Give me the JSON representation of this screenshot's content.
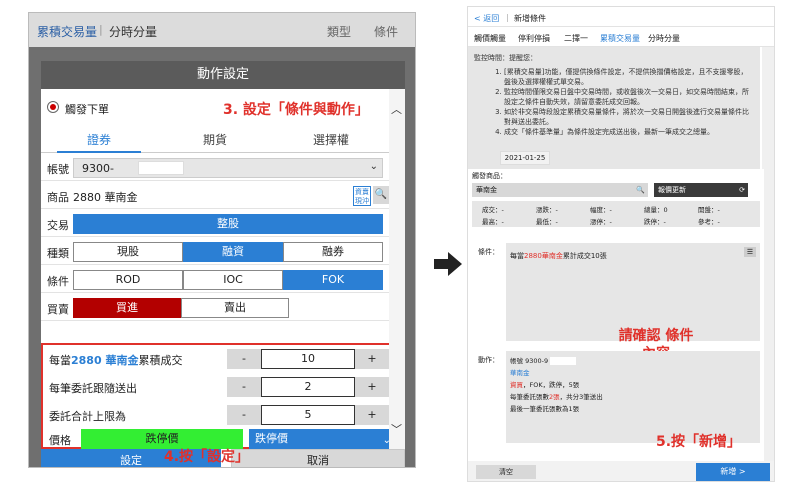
{
  "left": {
    "bg_tab1": "累積交易量",
    "bg_sep": "|",
    "bg_tab2": "分時分量",
    "bg_tab3": "類型",
    "bg_tab4": "條件",
    "dialog_title": "動作設定",
    "trigger_label": "觸發下單",
    "callout3": "3. 設定「條件與動作」",
    "tabs": [
      "證券",
      "期貨",
      "選擇權"
    ],
    "account_label": "帳號",
    "account_value": "9300-",
    "product_label": "商品",
    "product_value": "2880 華南金",
    "badge_text": "資賣現沖",
    "trade_label": "交易",
    "trade_value": "整股",
    "kind_label": "種類",
    "kinds": [
      "現股",
      "融資",
      "融券"
    ],
    "cond_label": "條件",
    "conds": [
      "ROD",
      "IOC",
      "FOK"
    ],
    "side_label": "買賣",
    "sides": [
      "買進",
      "賣出"
    ],
    "row1_pre": "每當",
    "row1_hl": "2880 華南金",
    "row1_post": "累積成交",
    "row1_value": "10",
    "row2_label": "每筆委託跟隨送出",
    "row2_value": "2",
    "row3_label": "委託合計上限為",
    "row3_value": "5",
    "minus": "-",
    "plus": "+",
    "unit": "張",
    "price_label": "價格",
    "price_green": "跌停價",
    "price_blue": "跌停價",
    "btn_set": "設定",
    "btn_cancel": "取消",
    "callout4": "4.按「設定」"
  },
  "right": {
    "back": "< 返回",
    "page_title": "新增條件",
    "tabs": [
      "觸價觸量",
      "停利停損",
      "二擇一",
      "累積交易量",
      "分時分量"
    ],
    "notes_title": "監控時間：提醒您：",
    "notes": [
      "[累積交易量]功能，僅提供換條件設定，不提供換擋價格設定，且不支援零股，盤後及選擇權權式單交易。",
      "監控時間僅限交易日盤中交易時間，或收盤後次一交易日，如交易時間結束，所設定之條件自動失效，請留意委託成交回報。",
      "如於非交易時段設定累積交易量條件，將於次一交易日開盤後進行交易量條件比對與送出委託。",
      "成交「條件基準量」為條件設定完成送出後，最新一筆成交之總量。"
    ],
    "date": "2021-01-25",
    "trigger_product": "觸發商品：",
    "product_input": "華南金",
    "quote_btn": "報價更新",
    "quote_row1": [
      "成交：-",
      "漲跌：-",
      "幅度：-",
      "總量：0",
      "開盤：-"
    ],
    "quote_row2": [
      "最高：-",
      "最低：-",
      "漲停：-",
      "跌停：-",
      "參考：-"
    ],
    "cond_label": "條件：",
    "cond_text_pre": "每當",
    "cond_text_hl": "2880華南金",
    "cond_text_post": "累計成交10張",
    "confirm_text": "請確認 條件內容",
    "action_label": "動作：",
    "action_account": "帳號 9300-9",
    "action_product": "華南金",
    "action_line1_hl": "資買",
    "action_line1": "，FOK，跌停，5張",
    "action_line2_pre": "每筆委託張數",
    "action_line2_hl": "2張",
    "action_line2_post": "，共分3筆送出",
    "action_line3": "最後一筆委託張數為1張",
    "clear_btn": "清空",
    "add_btn": "新增 >",
    "callout5": "5.按「新增」"
  }
}
